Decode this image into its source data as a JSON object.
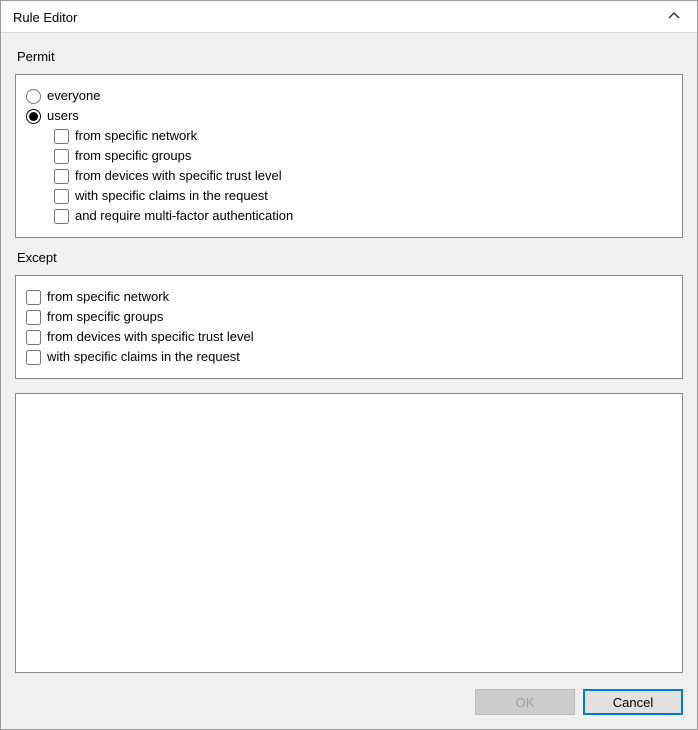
{
  "window": {
    "title": "Rule Editor"
  },
  "permit": {
    "label": "Permit",
    "radios": {
      "everyone": "everyone",
      "users": "users"
    },
    "checks": [
      "from specific network",
      "from specific groups",
      "from devices with specific trust level",
      "with specific claims in the request",
      "and require multi-factor authentication"
    ]
  },
  "except": {
    "label": "Except",
    "checks": [
      "from specific network",
      "from specific groups",
      "from devices with specific trust level",
      "with specific claims in the request"
    ]
  },
  "buttons": {
    "ok": "OK",
    "cancel": "Cancel"
  }
}
